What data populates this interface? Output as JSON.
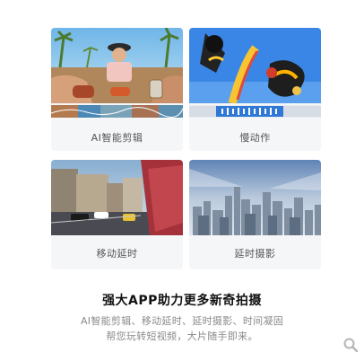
{
  "cards": [
    {
      "label": "AI智能剪辑"
    },
    {
      "label": "慢动作"
    },
    {
      "label": "移动延时"
    },
    {
      "label": "延时摄影"
    }
  ],
  "headline": "强大APP助力更多新奇拍摄",
  "subline_1": "AI智能剪辑、移动延时、延时摄影、时间凝固",
  "subline_2": "帮您玩转短视频，大片随手即来。",
  "icons": {
    "search": "search-icon"
  }
}
